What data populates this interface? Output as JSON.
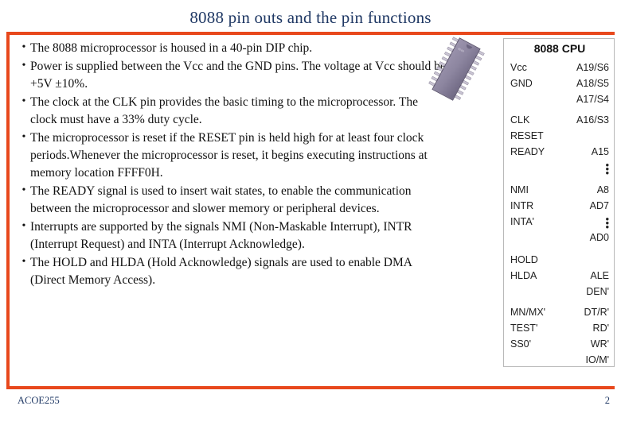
{
  "slide": {
    "title": "8088 pin outs and the pin functions",
    "accent_color": "#e8481c",
    "title_color": "#1f3864"
  },
  "bullets": [
    {
      "marker": "•",
      "text": "The 8088 microprocessor is housed in a 40-pin DIP chip."
    },
    {
      "marker": "•",
      "text": "Power is supplied between the Vcc and the GND pins. The voltage at Vcc should be +5V ±10%."
    },
    {
      "marker": "•",
      "text": "The clock at the CLK pin provides the basic timing to the microprocessor. The clock must have a 33% duty cycle."
    },
    {
      "marker": "•",
      "text": "The microprocessor is reset if the RESET pin is held high for at least four clock periods.Whenever the microprocessor is reset, it begins executing instructions at memory location FFFF0H."
    },
    {
      "marker": "•",
      "text": "The READY signal is used to insert wait states, to enable the communication between the microprocessor and slower memory or peripheral devices."
    },
    {
      "marker": "•",
      "text": "Interrupts are supported by the signals NMI (Non-Maskable Interrupt), INTR (Interrupt Request) and INTA (Interrupt Acknowledge)."
    },
    {
      "marker": "•",
      "text": "The HOLD and HLDA (Hold Acknowledge) signals are used to enable DMA (Direct Memory Access)."
    }
  ],
  "cpu_diagram": {
    "title": "8088 CPU",
    "chip_label": "8088",
    "rows": [
      {
        "left": "Vcc",
        "right": "A19/S6",
        "gap_before": 0
      },
      {
        "left": "GND",
        "right": "A18/S5",
        "gap_before": 0
      },
      {
        "left": "",
        "right": "A17/S4",
        "gap_before": 0
      },
      {
        "left": "CLK",
        "right": "A16/S3",
        "gap_before": 6
      },
      {
        "left": "RESET",
        "right": "",
        "gap_before": 0
      },
      {
        "left": "READY",
        "right": "A15",
        "gap_before": 0
      },
      {
        "left": "",
        "right": "vdots",
        "gap_before": 0
      },
      {
        "left": "NMI",
        "right": "A8",
        "gap_before": 8
      },
      {
        "left": "INTR",
        "right": "AD7",
        "gap_before": 0
      },
      {
        "left": "INTA'",
        "right": "vdots",
        "gap_before": 0
      },
      {
        "left": "",
        "right": "AD0",
        "gap_before": 0
      },
      {
        "left": "HOLD",
        "right": "",
        "gap_before": 8
      },
      {
        "left": "HLDA",
        "right": "ALE",
        "gap_before": 0
      },
      {
        "left": "",
        "right": "DEN'",
        "gap_before": 0
      },
      {
        "left": "MN/MX'",
        "right": "DT/R'",
        "gap_before": 6
      },
      {
        "left": "TEST'",
        "right": "RD'",
        "gap_before": 0
      },
      {
        "left": "SS0'",
        "right": "WR'",
        "gap_before": 0
      },
      {
        "left": "",
        "right": "IO/M'",
        "gap_before": 0
      }
    ]
  },
  "footer": {
    "left": "ACOE255",
    "right": "2"
  }
}
